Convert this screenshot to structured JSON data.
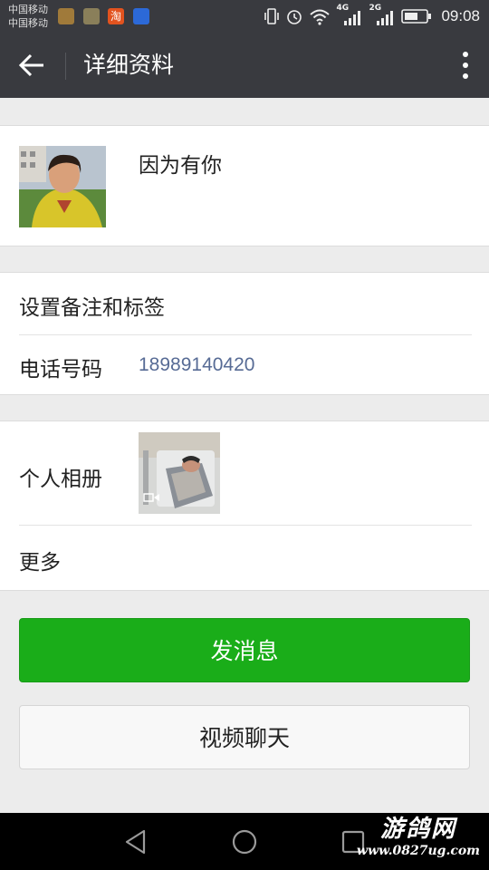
{
  "status_bar": {
    "carrier_1": "中国移动",
    "carrier_2": "中国移动",
    "net_1": "4G",
    "net_2": "2G",
    "time": "09:08",
    "notif_icons": [
      "app-icon-1",
      "app-icon-2",
      "taobao-icon",
      "baidu-icon"
    ],
    "taobao_glyph": "淘"
  },
  "header": {
    "title": "详细资料"
  },
  "profile": {
    "nickname": "因为有你"
  },
  "info": {
    "remark_label": "设置备注和标签",
    "phone_label": "电话号码",
    "phone_value": "18989140420"
  },
  "album": {
    "label": "个人相册",
    "more_label": "更多"
  },
  "actions": {
    "send_message": "发消息",
    "video_chat": "视频聊天"
  },
  "watermark": {
    "brand": "游鸽网",
    "url": "www.0827ug.com"
  },
  "colors": {
    "header_bg": "#393a3f",
    "primary_green": "#1aad19",
    "link_blue": "#576b95",
    "page_bg": "#ececec"
  }
}
